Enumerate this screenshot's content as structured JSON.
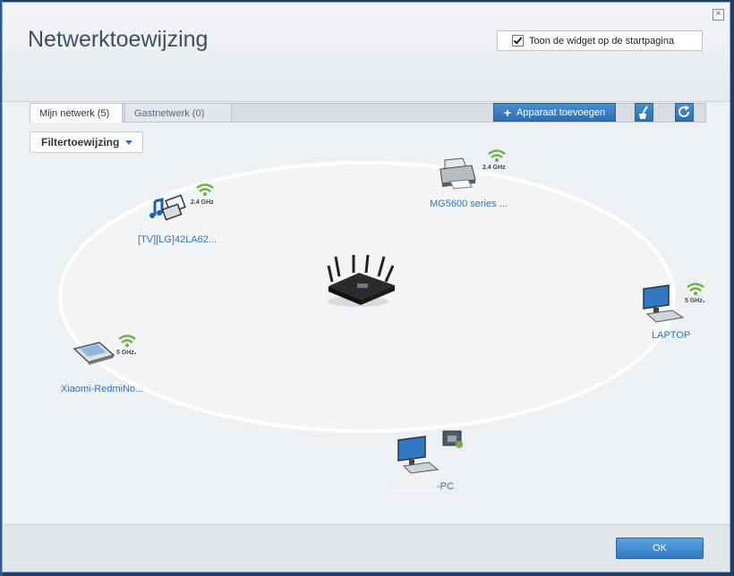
{
  "window": {
    "title": "Netwerktoewijzing",
    "close_label": "×",
    "widget_toggle": {
      "label": "Toon de widget op de startpagina",
      "checked": true
    }
  },
  "tabs": [
    {
      "label": "Mijn netwerk (5)",
      "active": true
    },
    {
      "label": "Gastnetwerk (0)",
      "active": false
    }
  ],
  "toolbar": {
    "add_device_label": "Apparaat toevoegen",
    "add_device_icon": "plus-icon",
    "clean_icon": "broom-icon",
    "refresh_icon": "refresh-icon"
  },
  "filter": {
    "label": "Filtertoewijzing"
  },
  "devices": [
    {
      "label": "[TV][LG]42LA62...",
      "freq": "2.4 GHz",
      "connection": "wifi",
      "icon": "media-tv-icon"
    },
    {
      "label": "MG5600 series ...",
      "freq": "2.4 GHz",
      "connection": "wifi",
      "icon": "printer-icon"
    },
    {
      "label": "LAPTOP",
      "freq": "5 GHz₁",
      "connection": "wifi",
      "icon": "computer-icon"
    },
    {
      "label": "Xiaomi-RedmiNo...",
      "freq": "5 GHz₁",
      "connection": "wifi",
      "icon": "tablet-icon"
    },
    {
      "label": "-PC",
      "freq": "",
      "connection": "ethernet",
      "icon": "computer-icon"
    }
  ],
  "footer": {
    "ok_label": "OK"
  },
  "colors": {
    "accent": "#2f76b7",
    "wifi": "#6bb43f",
    "title": "#3d4f62"
  }
}
